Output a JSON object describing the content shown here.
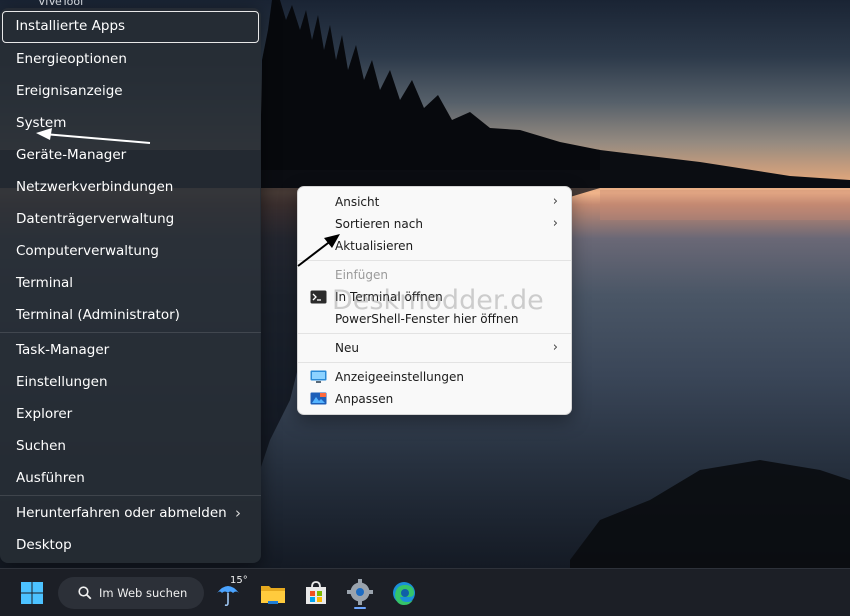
{
  "desktop": {
    "top_label": "ViVeTool"
  },
  "winx_menu": {
    "groups": [
      [
        {
          "label": "Installierte Apps",
          "selected": true
        },
        {
          "label": "Energieoptionen"
        },
        {
          "label": "Ereignisanzeige"
        },
        {
          "label": "System"
        },
        {
          "label": "Geräte-Manager"
        },
        {
          "label": "Netzwerkverbindungen"
        },
        {
          "label": "Datenträgerverwaltung"
        },
        {
          "label": "Computerverwaltung"
        },
        {
          "label": "Terminal"
        },
        {
          "label": "Terminal (Administrator)"
        }
      ],
      [
        {
          "label": "Task-Manager"
        },
        {
          "label": "Einstellungen"
        },
        {
          "label": "Explorer"
        },
        {
          "label": "Suchen"
        },
        {
          "label": "Ausführen"
        }
      ],
      [
        {
          "label": "Herunterfahren oder abmelden",
          "submenu": true
        },
        {
          "label": "Desktop"
        }
      ]
    ]
  },
  "context_menu": {
    "items": [
      {
        "label": "Ansicht",
        "submenu": true
      },
      {
        "label": "Sortieren nach",
        "submenu": true
      },
      {
        "label": "Aktualisieren"
      },
      {
        "separator": true
      },
      {
        "label": "Einfügen",
        "disabled": true
      },
      {
        "label": "In Terminal öffnen",
        "icon": "terminal-icon"
      },
      {
        "label": "PowerShell-Fenster hier öffnen"
      },
      {
        "separator": true
      },
      {
        "label": "Neu",
        "submenu": true
      },
      {
        "separator": true
      },
      {
        "label": "Anzeigeeinstellungen",
        "icon": "display-settings-icon"
      },
      {
        "label": "Anpassen",
        "icon": "personalize-icon"
      }
    ],
    "chevron": "›"
  },
  "watermark": "Deskmodder.de",
  "taskbar": {
    "search_label": "Im Web suchen",
    "weather_temp": "15°"
  },
  "colors": {
    "accent_blue": "#0f7bd8",
    "menu_bg": "#262c34",
    "context_bg": "#f9f9f9"
  }
}
